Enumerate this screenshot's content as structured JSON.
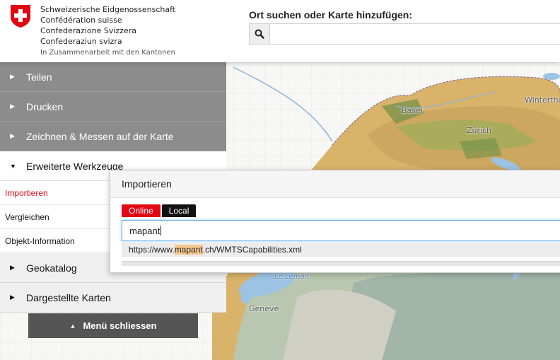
{
  "header": {
    "confederation": [
      "Schweizerische Eidgenossenschaft",
      "Confédération suisse",
      "Confederazione Svizzera",
      "Confederaziun svizra"
    ],
    "cooperation": "In Zusammenarbeit mit den Kantonen",
    "search_label": "Ort suchen oder Karte hinzufügen:",
    "search_value": "",
    "search_icon": "magnifier-icon"
  },
  "menu": {
    "items": [
      {
        "label": "Teilen",
        "icon": "triangle-right"
      },
      {
        "label": "Drucken",
        "icon": "triangle-right"
      },
      {
        "label": "Zeichnen & Messen auf der Karte",
        "icon": "triangle-right"
      },
      {
        "label": "Erweiterte Werkzeuge",
        "icon": "triangle-down"
      }
    ],
    "sub_items": [
      "Importieren",
      "Vergleichen",
      "Objekt-Information"
    ],
    "bottom_items": [
      {
        "label": "Geokatalog",
        "icon": "triangle-right"
      },
      {
        "label": "Dargestellte Karten",
        "icon": "triangle-right"
      }
    ],
    "close_label": "Menü schliessen"
  },
  "dialog": {
    "title": "Importieren",
    "tab_online": "Online",
    "tab_local": "Local",
    "url_value": "mapant",
    "suggestion_prefix": "https://www.",
    "suggestion_match": "mapant",
    "suggestion_suffix": ".ch/WMTSCapabilities.xml"
  },
  "map": {
    "labels": [
      "Basel",
      "Zürich",
      "Winterthur",
      "Genève"
    ],
    "lake_labels": [
      "Le Léman"
    ]
  },
  "colors": {
    "accent_red": "#e30613",
    "menu_gray": "#8c8c8c",
    "button_dark": "#555555"
  }
}
